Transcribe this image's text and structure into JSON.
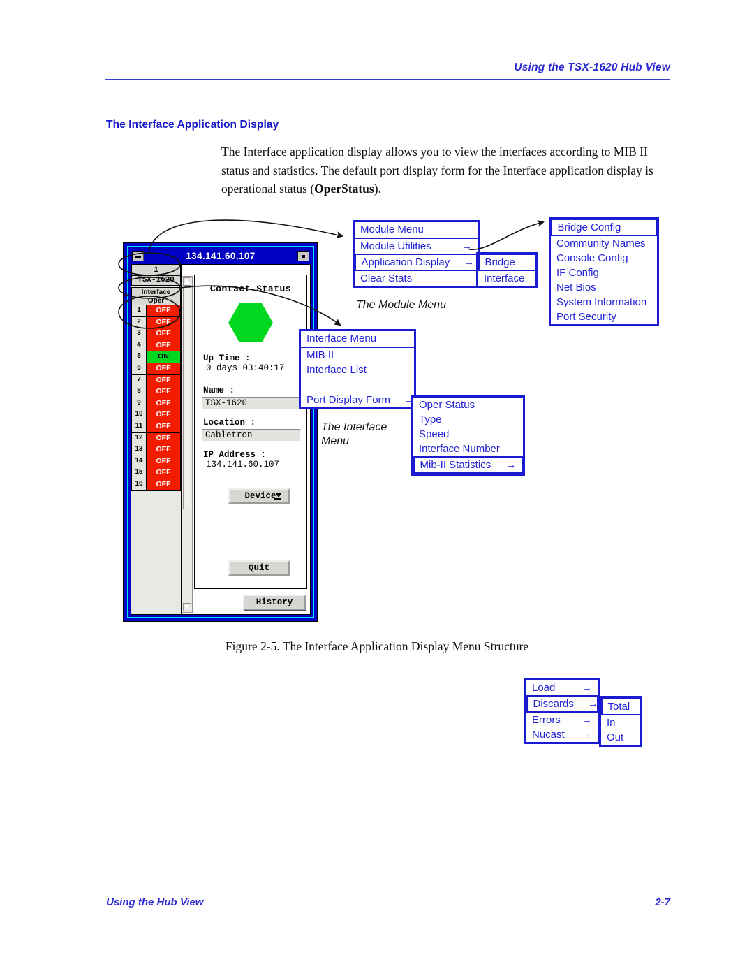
{
  "header": {
    "running_head": "Using the TSX-1620 Hub View"
  },
  "section": {
    "heading": "The Interface Application Display",
    "paragraph_part1": "The Interface application display allows you to view the interfaces according to MIB II status and statistics. The default port display form for the Interface application display is operational status (",
    "paragraph_bold": "OperStatus",
    "paragraph_part2": ")."
  },
  "figure": {
    "caption": "Figure 2-5.  The Interface Application Display Menu Structure",
    "hub_window": {
      "title": "134.141.60.107",
      "minimize_label": "—",
      "maximize_label": "▪",
      "slot_number": "1",
      "slot_model": "TSX-1620",
      "interface_header_line1": "Interface",
      "interface_header_line2": "Oper",
      "ports": [
        {
          "index": "1",
          "state": "OFF"
        },
        {
          "index": "2",
          "state": "OFF"
        },
        {
          "index": "3",
          "state": "OFF"
        },
        {
          "index": "4",
          "state": "OFF"
        },
        {
          "index": "5",
          "state": "ON"
        },
        {
          "index": "6",
          "state": "OFF"
        },
        {
          "index": "7",
          "state": "OFF"
        },
        {
          "index": "8",
          "state": "OFF"
        },
        {
          "index": "9",
          "state": "OFF"
        },
        {
          "index": "10",
          "state": "OFF"
        },
        {
          "index": "11",
          "state": "OFF"
        },
        {
          "index": "12",
          "state": "OFF"
        },
        {
          "index": "13",
          "state": "OFF"
        },
        {
          "index": "14",
          "state": "OFF"
        },
        {
          "index": "15",
          "state": "OFF"
        },
        {
          "index": "16",
          "state": "OFF"
        }
      ],
      "device_panel": {
        "contact_status_title": "Contact Status",
        "contact_status_color": "#00d820",
        "uptime_label": "Up Time :",
        "uptime_value": "0 days 03:40:17",
        "name_label": "Name :",
        "name_value": "TSX-1620",
        "location_label": "Location :",
        "location_value": "Cabletron",
        "ip_label": "IP Address :",
        "ip_value": "134.141.60.107",
        "device_button": "Device",
        "quit_button": "Quit"
      },
      "history_button": "History"
    },
    "module_menu": {
      "title": "Module Menu",
      "items": [
        {
          "label": "Module Utilities",
          "arrow": "→",
          "selected": false
        },
        {
          "label": "Application Display",
          "arrow": "→",
          "selected": true
        },
        {
          "label": "Clear Stats",
          "arrow": "",
          "selected": false
        }
      ],
      "caption": "The Module Menu"
    },
    "application_display_submenu": {
      "items": [
        {
          "label": "Bridge",
          "selected": true
        },
        {
          "label": "Interface",
          "selected": false
        }
      ]
    },
    "module_utilities_submenu": {
      "items": [
        {
          "label": "Bridge Config",
          "selected": true
        },
        {
          "label": "Community Names",
          "selected": false
        },
        {
          "label": "Console Config",
          "selected": false
        },
        {
          "label": "IF Config",
          "selected": false
        },
        {
          "label": "Net Bios",
          "selected": false
        },
        {
          "label": "System Information",
          "selected": false
        },
        {
          "label": "Port Security",
          "selected": false
        }
      ]
    },
    "interface_menu": {
      "title": "Interface Menu",
      "items": [
        {
          "label": "MIB II",
          "arrow": "",
          "selected": false
        },
        {
          "label": "Interface List",
          "arrow": "",
          "selected": false
        },
        {
          "label": "",
          "arrow": "",
          "selected": false
        },
        {
          "label": "Port Display Form",
          "arrow": "→",
          "selected": false
        }
      ],
      "caption_line1": "The Interface",
      "caption_line2": "Menu"
    },
    "port_display_form_submenu": {
      "items": [
        {
          "label": "Oper Status",
          "arrow": "",
          "selected": false
        },
        {
          "label": "Type",
          "arrow": "",
          "selected": false
        },
        {
          "label": "Speed",
          "arrow": "",
          "selected": false
        },
        {
          "label": "Interface Number",
          "arrow": "",
          "selected": false
        },
        {
          "label": "Mib-II Statistics",
          "arrow": "→",
          "selected": true
        }
      ]
    },
    "mib_statistics_submenu": {
      "items": [
        {
          "label": "Load",
          "arrow": "→",
          "selected": false
        },
        {
          "label": "Discards",
          "arrow": "→",
          "selected": true
        },
        {
          "label": "Errors",
          "arrow": "→",
          "selected": false
        },
        {
          "label": "Nucast",
          "arrow": "→",
          "selected": false
        }
      ]
    },
    "discards_submenu": {
      "items": [
        {
          "label": "Total",
          "selected": true
        },
        {
          "label": "In",
          "selected": false
        },
        {
          "label": "Out",
          "selected": false
        }
      ]
    }
  },
  "footer": {
    "left": "Using the Hub View",
    "right": "2-7"
  }
}
